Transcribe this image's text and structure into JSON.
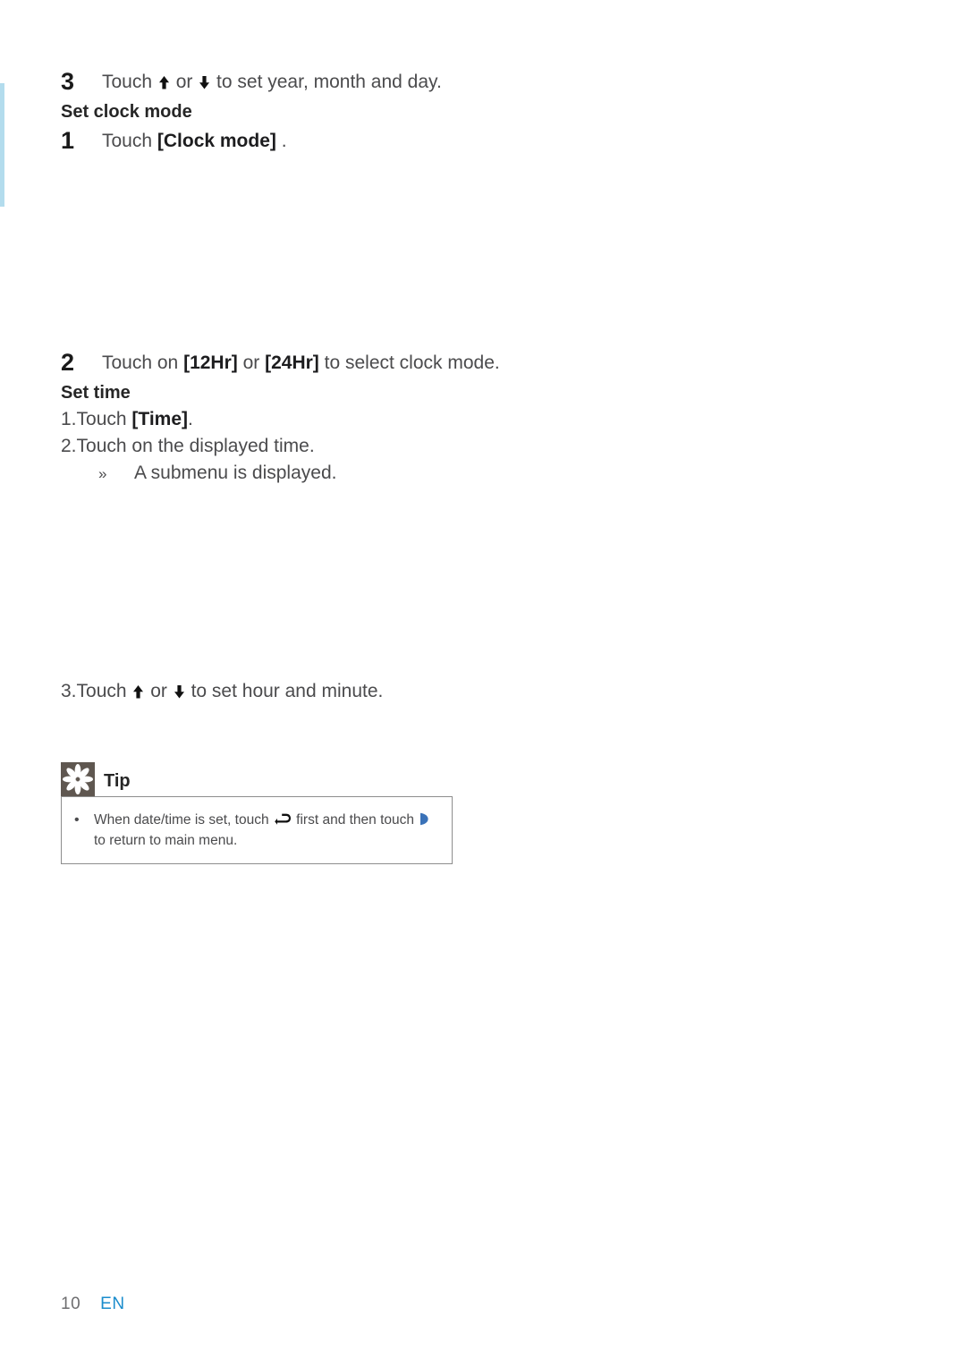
{
  "page": {
    "number": "10",
    "language": "EN",
    "accent_rule_color": "#b3dced",
    "link_color": "#1a8ccc",
    "tip_badge_color": "#5f5750"
  },
  "blocks": {
    "step3_top": {
      "number": "3",
      "text_before": "Touch ",
      "text_middle": " or ",
      "text_after": " to set year, month and day."
    },
    "heading_clock_mode": "Set clock mode",
    "step1": {
      "number": "1",
      "text_before": "Touch ",
      "bold": "[Clock mode]",
      "text_after": " ."
    },
    "step2": {
      "number": "2",
      "text_before": "Touch on ",
      "bold1": "[12Hr]",
      "text_mid": " or ",
      "bold2": "[24Hr]",
      "text_after": " to select clock mode."
    },
    "heading_set_time": "Set time",
    "time_steps": [
      {
        "marker": "1.",
        "text_before": "Touch ",
        "bold": "[Time]",
        "text_after": "."
      },
      {
        "marker": "2.",
        "text_before": "Touch on the displayed time.",
        "bold": "",
        "text_after": ""
      }
    ],
    "submenu_result": {
      "marker": "»",
      "text": "A submenu is displayed."
    },
    "step3_bottom": {
      "marker": "3.",
      "text_before": "Touch ",
      "text_middle": " or ",
      "text_after": " to set hour and minute."
    }
  },
  "tip": {
    "title": "Tip",
    "bullet": "•",
    "text_part1": "When date/time is set, touch ",
    "text_part2": " first and then touch ",
    "text_part3": " to return to main menu.",
    "return_icon_name": "return-arrow-icon",
    "next_icon_name": "next-navigate-icon"
  },
  "icons": {
    "arrow_up": "arrow-up-filled-icon",
    "arrow_down": "arrow-down-filled-icon",
    "tip_badge": "asterisk-flower-icon"
  }
}
